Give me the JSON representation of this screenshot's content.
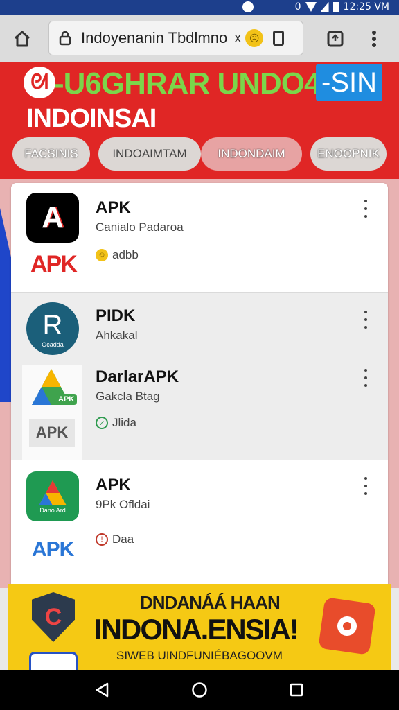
{
  "status_bar": {
    "indicator": "0",
    "time": "12:25 VM"
  },
  "browser": {
    "url_text": "Indoyenanin Tbdlmno",
    "close_label": "x"
  },
  "hero": {
    "title": "-U6GHRAR UNDO4N",
    "badge": "-SIN",
    "subtitle": "INDOINSAI",
    "chips": [
      "FACSINIS",
      "INDOAIMTAM",
      "INDONDAIM",
      "ENOOPNIK"
    ]
  },
  "apps": [
    {
      "title": "APK",
      "subtitle": "Canialo Padaroa",
      "meta": "adbb",
      "icon_text": "A",
      "brand": "APK"
    },
    {
      "title": "PIDK",
      "subtitle": "Ahkakal",
      "icon_text": "R",
      "icon_caption": "Ocadda"
    },
    {
      "title": "DarlarAPK",
      "subtitle": "Gakcla Btag",
      "meta": "Jlida",
      "brand": "APK",
      "tag": "APK"
    },
    {
      "title": "APK",
      "subtitle": "9Pk Ofldai",
      "meta": "Daa",
      "brand": "APK",
      "icon_caption": "Dano Ard"
    }
  ],
  "banner": {
    "line1": "DNDANÁÁ HAAN",
    "line2": "INDONA.ENSIA!",
    "line3": "SIWEB UINDFUNIÉBAGOOVM"
  },
  "colors": {
    "accent": "#e02625",
    "banner": "#f5c914",
    "status": "#1d3f8c"
  },
  "icons": [
    "home-icon",
    "lock-icon",
    "tabs-icon",
    "more-vert-icon",
    "back-icon",
    "home-circle-icon",
    "recents-icon"
  ]
}
